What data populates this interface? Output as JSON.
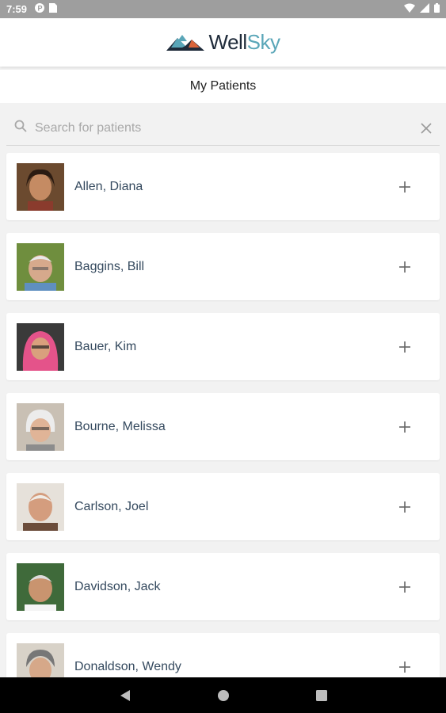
{
  "status_bar": {
    "time": "7:59",
    "left_icons": [
      "pinterest-icon",
      "sim-card-icon"
    ],
    "right_icons": [
      "wifi-icon",
      "signal-icon",
      "battery-icon"
    ]
  },
  "app": {
    "brand_part1": "Well",
    "brand_part2": "Sky",
    "colors": {
      "brand_dark": "#1f2b3a",
      "brand_teal": "#5aa6b8",
      "brand_orange": "#d9643a"
    }
  },
  "page": {
    "title": "My Patients"
  },
  "search": {
    "placeholder": "Search for patients",
    "value": ""
  },
  "patients": [
    {
      "name": "Allen, Diana"
    },
    {
      "name": "Baggins, Bill"
    },
    {
      "name": "Bauer, Kim"
    },
    {
      "name": "Bourne, Melissa"
    },
    {
      "name": "Carlson, Joel"
    },
    {
      "name": "Davidson, Jack"
    },
    {
      "name": "Donaldson, Wendy"
    }
  ],
  "nav": {
    "icons": [
      "back-icon",
      "home-icon",
      "recents-icon"
    ]
  }
}
